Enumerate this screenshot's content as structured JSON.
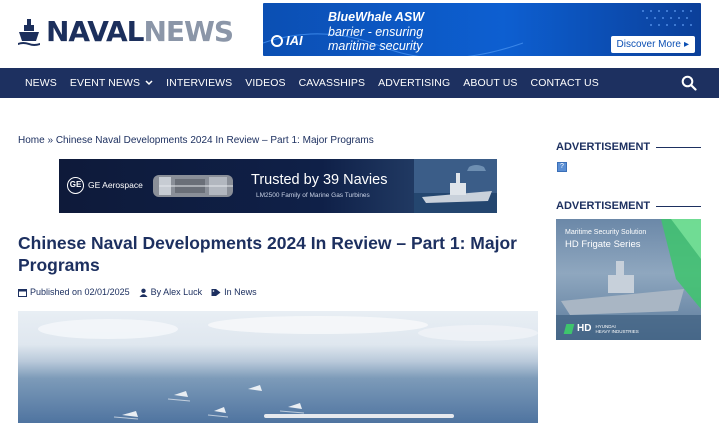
{
  "site": {
    "logo_naval": "NAVAL",
    "logo_news": "NEWS"
  },
  "top_ad": {
    "line1": "BlueWhale ASW",
    "line2": "barrier - ensuring",
    "line3": "maritime security",
    "brand": "IAI",
    "cta": "Discover More"
  },
  "nav": {
    "items": [
      "NEWS",
      "EVENT NEWS",
      "INTERVIEWS",
      "VIDEOS",
      "CAVASSHIPS",
      "ADVERTISING",
      "ABOUT US",
      "CONTACT US"
    ]
  },
  "breadcrumb": {
    "home": "Home",
    "separator": "»",
    "current": "Chinese Naval Developments 2024 In Review – Part 1: Major Programs"
  },
  "mid_ad": {
    "brand": "GE Aerospace",
    "headline": "Trusted by 39 Navies",
    "subline": "LM2500 Family of Marine Gas Turbines"
  },
  "article": {
    "title": "Chinese Naval Developments 2024 In Review – Part 1: Major Programs",
    "published": "Published on 02/01/2025",
    "author": "By Alex Luck",
    "category": "In News"
  },
  "sidebar": {
    "ad_heading_1": "ADVERTISEMENT",
    "ad_heading_2": "ADVERTISEMENT",
    "side_ad": {
      "kicker": "Maritime Security Solution",
      "headline": "HD Frigate Series",
      "brand": "HD",
      "brand_sub_1": "HYUNDAI",
      "brand_sub_2": "HEAVY INDUSTRIES"
    }
  },
  "colors": {
    "navy": "#1d3060",
    "ad_blue": "#0b4fb3",
    "hd_green": "#3ec46d"
  }
}
